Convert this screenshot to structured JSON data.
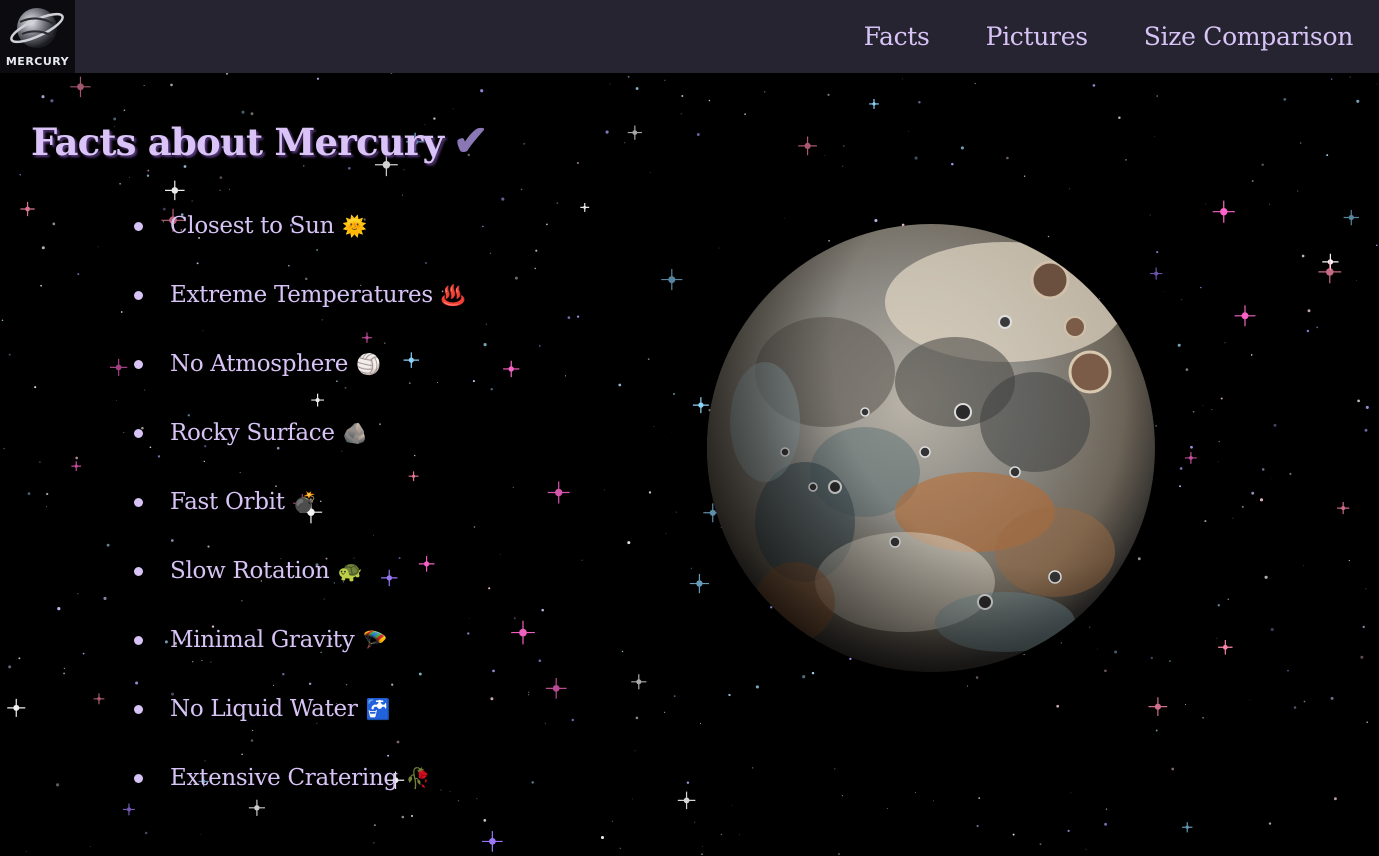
{
  "logo": {
    "text": "MERCURY"
  },
  "nav": {
    "links": [
      {
        "label": "Facts"
      },
      {
        "label": "Pictures"
      },
      {
        "label": "Size Comparison"
      }
    ]
  },
  "main": {
    "title": "Facts about Mercury",
    "title_icon": "✔",
    "facts": [
      {
        "label": "Closest to Sun",
        "emoji": "🌞",
        "icon": "sun-face-icon"
      },
      {
        "label": "Extreme Temperatures",
        "emoji": "♨️",
        "icon": "hot-springs-icon"
      },
      {
        "label": "No Atmosphere",
        "emoji": "🏐",
        "icon": "volleyball-icon"
      },
      {
        "label": "Rocky Surface",
        "emoji": "🪨",
        "icon": "rock-icon"
      },
      {
        "label": "Fast Orbit",
        "emoji": "💣",
        "icon": "bomb-icon"
      },
      {
        "label": "Slow Rotation",
        "emoji": "🐢",
        "icon": "turtle-icon"
      },
      {
        "label": "Minimal Gravity",
        "emoji": "🪂",
        "icon": "parachute-icon"
      },
      {
        "label": "No Liquid Water",
        "emoji": "🚰",
        "icon": "potable-water-icon"
      },
      {
        "label": "Extensive Cratering",
        "emoji": "🥀",
        "icon": "wilted-flower-icon"
      }
    ]
  },
  "colors": {
    "background": "#000000",
    "navbar": "#262431",
    "text": "#d7c3f5",
    "title_shadow": "#5b3c80"
  }
}
